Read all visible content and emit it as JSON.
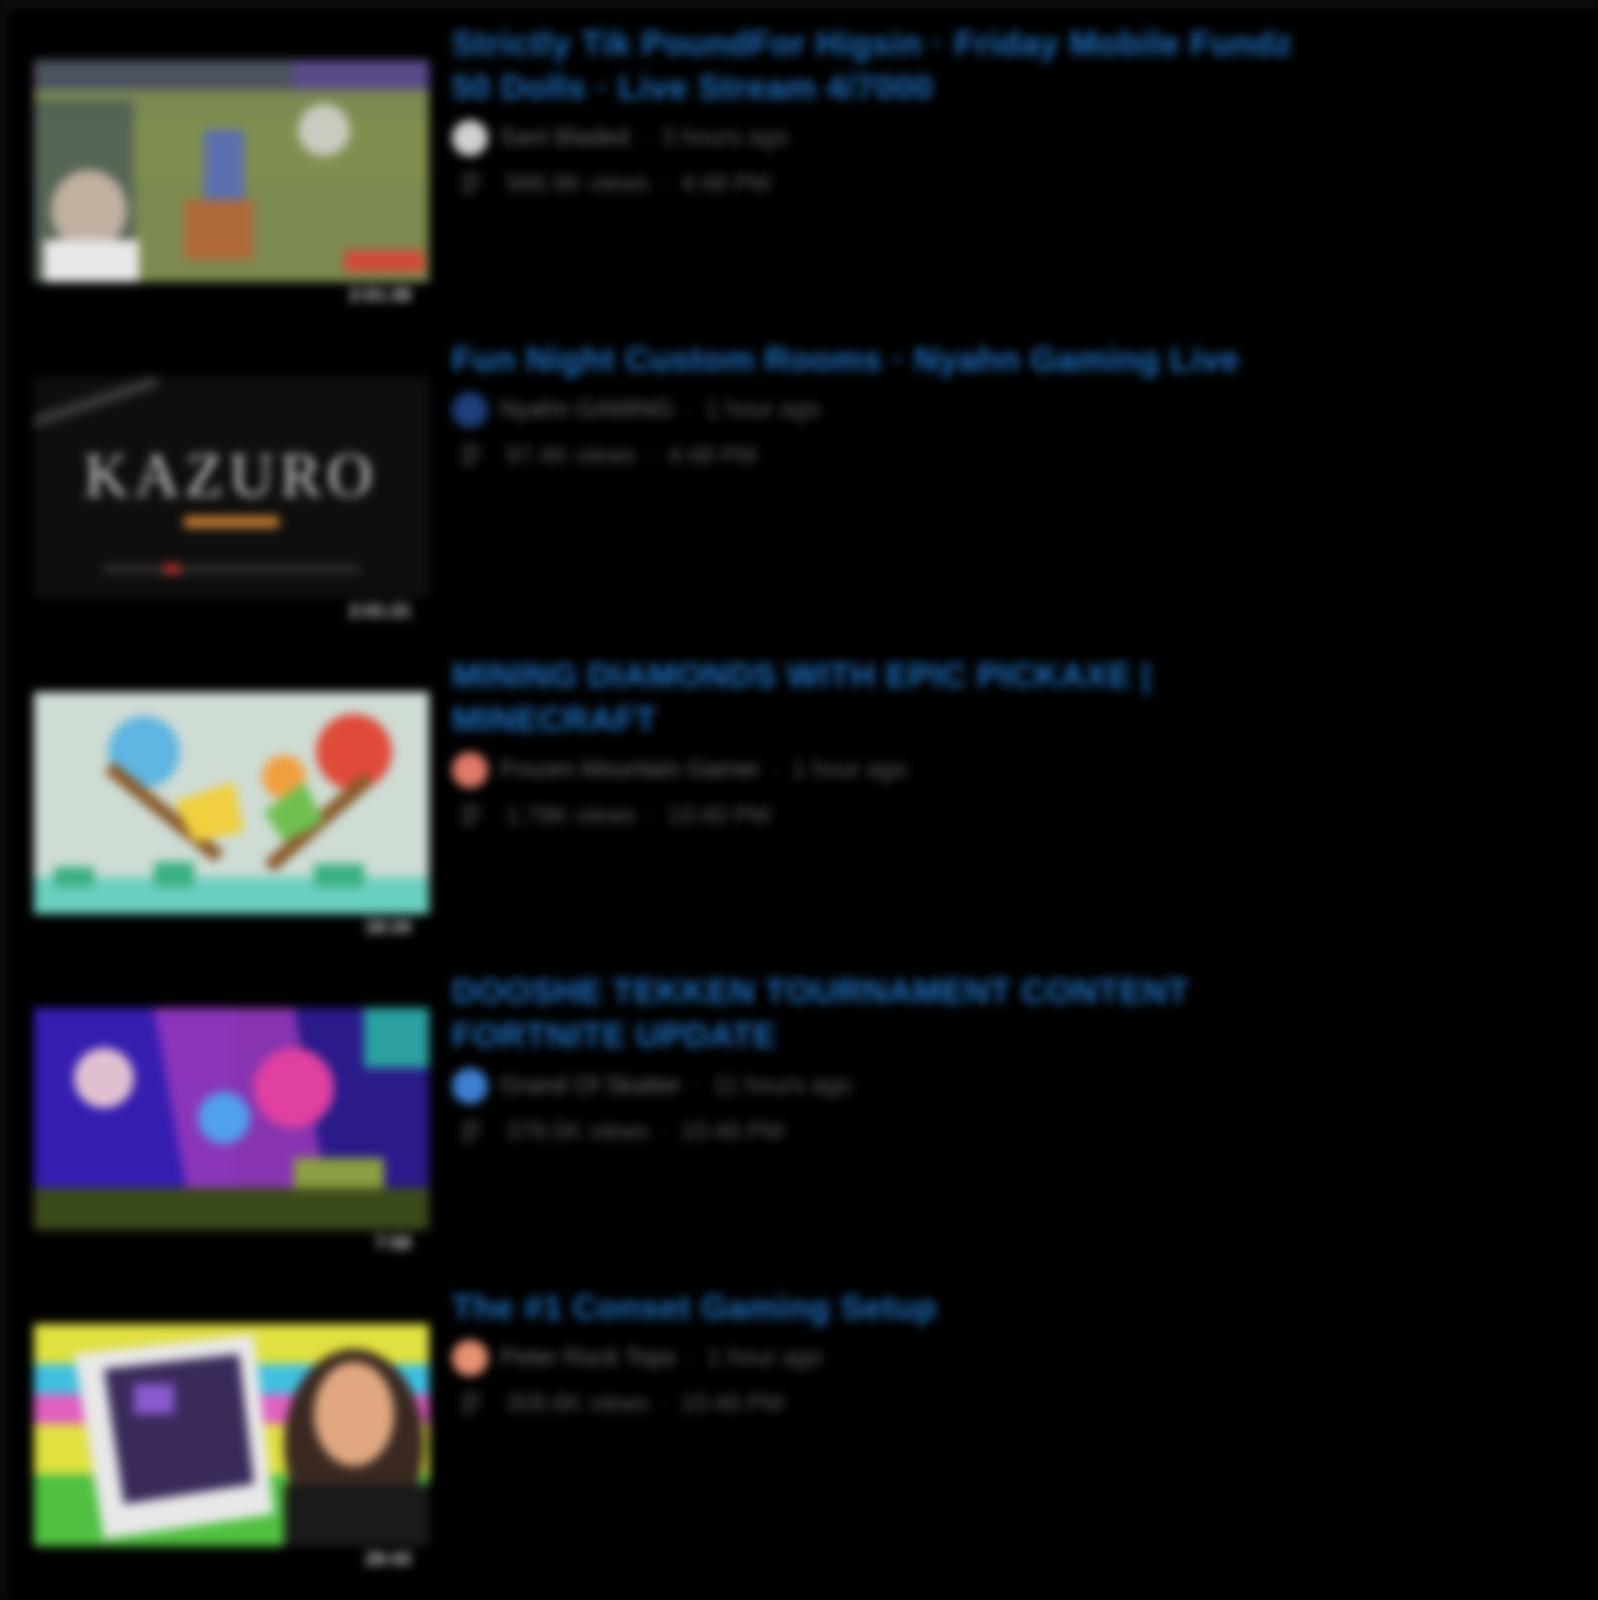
{
  "colors": {
    "background": "#000000",
    "title_link": "#1f6fbf",
    "meta_text": "#5a5a5a"
  },
  "videos": [
    {
      "title": "Strictly Tik PoundFor Higsin · Friday Mobile Fundz 50 Dolls · Live Stream 4/7000",
      "channel": "Sani Bladed",
      "age": "3 hours ago",
      "views": "986.9K views",
      "time": "4:48 PM",
      "duration": "2:01:38",
      "avatar_color": "#d0d0d0",
      "thumbnail": "soccer-field"
    },
    {
      "title": "Fun Night Custom Rooms · Nyahn Gaming Live",
      "channel": "Nyahn GAMING",
      "age": "1 hour ago",
      "views": "97.4K views",
      "time": "4:48 PM",
      "duration": "2:01:21",
      "avatar_color": "#1d3f7a",
      "thumbnail": "kazuro-logo"
    },
    {
      "title": "MINING DIAMONDS WITH EPIC PICKAXE | MINECRAFT",
      "channel": "Frozen Mountain Gamer",
      "age": "1 hour ago",
      "views": "1.78K views",
      "time": "10:40 PM",
      "duration": "18:34",
      "avatar_color": "#e07a6a",
      "thumbnail": "pickaxes"
    },
    {
      "title": "DOOSHE TEKKEN TOURNAMENT CONTENT FORTNITE UPDATE",
      "channel": "Grand Of Skatter",
      "age": "11 hours ago",
      "views": "378.5K views",
      "time": "10:46 PM",
      "duration": "7:58",
      "avatar_color": "#3d7fd1",
      "thumbnail": "neon-game"
    },
    {
      "title": "The #1 Conset Gaming Setup",
      "channel": "Peter Rock Tops",
      "age": "1 hour ago",
      "views": "308.6K views",
      "time": "10:46 PM",
      "duration": "28:43",
      "avatar_color": "#e89070",
      "thumbnail": "handheld-device"
    }
  ],
  "icons": {
    "list": "list-icon",
    "avatar": "channel-avatar"
  }
}
